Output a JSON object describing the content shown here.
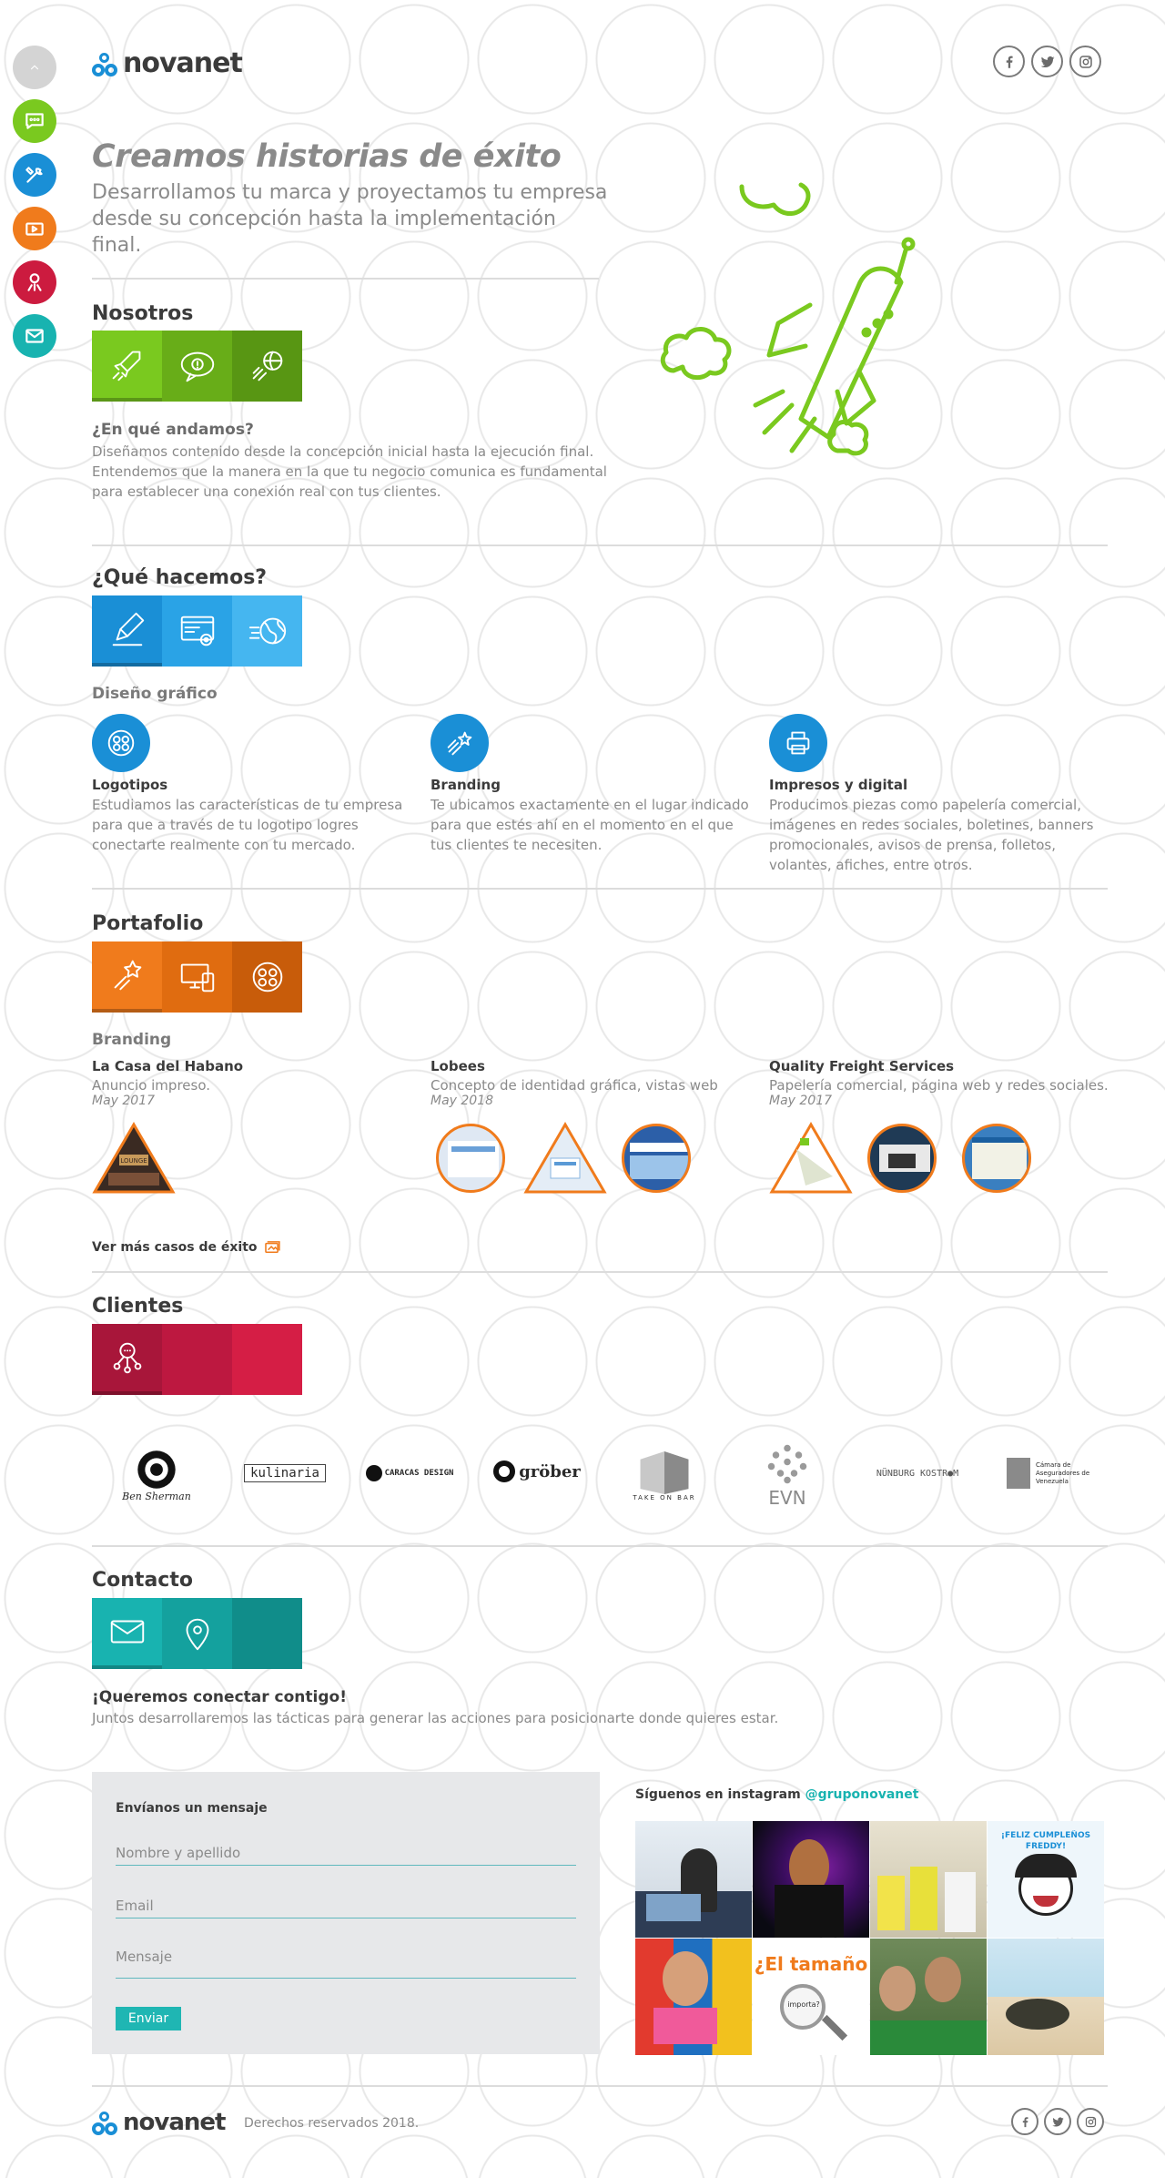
{
  "brand": {
    "name": "novanet",
    "colors": {
      "blue": "#1a8fd6",
      "green": "#7ac91f",
      "orange": "#f07b1c",
      "red": "#cc1b3f",
      "teal": "#18b3b0"
    }
  },
  "sidenav": [
    {
      "name": "up",
      "icon": "chevron-up-icon",
      "color": "#d4d4d4"
    },
    {
      "name": "nosotros",
      "icon": "chat-icon",
      "color": "#7ac91f"
    },
    {
      "name": "que-hacemos",
      "icon": "tools-icon",
      "color": "#1a8fd6"
    },
    {
      "name": "portafolio",
      "icon": "folder-icon",
      "color": "#f07b1c"
    },
    {
      "name": "clientes",
      "icon": "people-icon",
      "color": "#cc1b3f"
    },
    {
      "name": "contacto",
      "icon": "mail-icon",
      "color": "#18b3b0"
    }
  ],
  "social": [
    {
      "name": "facebook",
      "icon": "facebook-icon"
    },
    {
      "name": "twitter",
      "icon": "twitter-icon"
    },
    {
      "name": "instagram",
      "icon": "instagram-icon"
    }
  ],
  "hero": {
    "title": "Creamos historias de éxito",
    "subtitle": "Desarrollamos tu marca y proyectamos tu empresa desde su concepción hasta la implementación final."
  },
  "nosotros": {
    "title": "Nosotros",
    "heading": "¿En qué andamos?",
    "text": "Diseñamos contenido desde la concepción inicial hasta la ejecución final. Entendemos que la manera en la que tu negocio comunica es fundamental para establecer una conexión real con tus clientes."
  },
  "que_hacemos": {
    "title": "¿Qué hacemos?",
    "subtitle": "Diseño gráfico",
    "services": [
      {
        "title": "Logotipos",
        "text": "Estudiamos las características de tu empresa para que a través de tu logotipo logres conectarte realmente con tu mercado."
      },
      {
        "title": "Branding",
        "text": "Te ubicamos exactamente en el lugar indicado para que estés ahí en el momento en el que tus clientes te necesiten."
      },
      {
        "title": "Impresos y digital",
        "text": "Producimos piezas como papelería comercial, imágenes en redes sociales, boletines, banners promocionales, avisos de prensa, folletos, volantes, afiches, entre otros."
      }
    ]
  },
  "portafolio": {
    "title": "Portafolio",
    "subtitle": "Branding",
    "items": [
      {
        "title": "La Casa del Habano",
        "desc": "Anuncio impreso.",
        "date": "May 2017"
      },
      {
        "title": "Lobees",
        "desc": "Concepto de identidad gráfica, vistas web",
        "date": "May 2018"
      },
      {
        "title": "Quality Freight Services",
        "desc": "Papelería comercial, página web y redes sociales.",
        "date": "May 2017"
      }
    ],
    "more_link": "Ver más casos de éxito"
  },
  "clientes": {
    "title": "Clientes",
    "logos": [
      {
        "name": "ben-sherman",
        "text": "Ben Sherman"
      },
      {
        "name": "kulinaria",
        "text": "kulinaria"
      },
      {
        "name": "caracas-design",
        "text": "CARACAS DESIGN"
      },
      {
        "name": "grober",
        "text": "gröber"
      },
      {
        "name": "take-on-bar",
        "text": "TAKE ON BAR"
      },
      {
        "name": "evn",
        "text": "EVN"
      },
      {
        "name": "nunburg-kostrom",
        "text": "NÜNBURG KOSTR●M"
      },
      {
        "name": "camara-aseguradores",
        "text": "Cámara de Aseguradores de Venezuela"
      }
    ]
  },
  "contacto": {
    "title": "Contacto",
    "heading": "¡Queremos conectar contigo!",
    "text": "Juntos desarrollaremos las tácticas para generar las acciones para posicionarte donde quieres estar.",
    "form": {
      "title": "Envíanos un mensaje",
      "name_placeholder": "Nombre y apellido",
      "email_placeholder": "Email",
      "message_placeholder": "Mensaje",
      "submit": "Enviar"
    },
    "instagram": {
      "label": "Síguenos en instagram",
      "handle": "@gruponovanet",
      "post_texts": [
        "¡FELIZ CUMPLEÑOS FREDDY!",
        "¿El tamaño",
        "importa?"
      ]
    }
  },
  "footer": {
    "copyright": "Derechos reservados 2018."
  }
}
